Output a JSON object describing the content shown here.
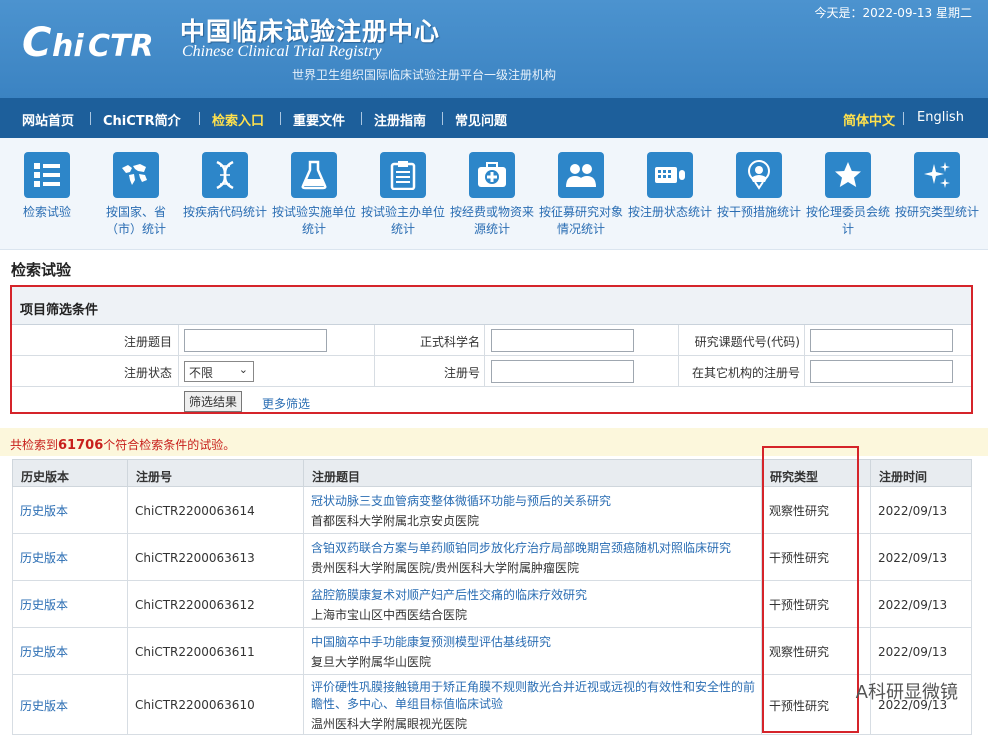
{
  "header": {
    "logo_text": "ChiCTR",
    "title_cn": "中国临床试验注册中心",
    "title_en": "Chinese Clinical Trial Registry",
    "subtitle": "世界卫生组织国际临床试验注册平台一级注册机构",
    "today": "今天是：2022-09-13 星期二",
    "brand_color": "#3f89c8"
  },
  "nav": {
    "items": [
      "网站首页",
      "ChiCTR简介",
      "检索入口",
      "重要文件",
      "注册指南",
      "常见问题"
    ],
    "active": "检索入口",
    "lang_cn": "简体中文",
    "lang_en": "English"
  },
  "icons": [
    {
      "label": "检索试验",
      "icon": "list-icon"
    },
    {
      "label": "按国家、省（市）统计",
      "icon": "map-icon"
    },
    {
      "label": "按疾病代码统计",
      "icon": "dna-icon"
    },
    {
      "label": "按试验实施单位统计",
      "icon": "flask-icon"
    },
    {
      "label": "按试验主办单位统计",
      "icon": "clipboard-icon"
    },
    {
      "label": "按经费或物资来源统计",
      "icon": "medkit-icon"
    },
    {
      "label": "按征募研究对象情况统计",
      "icon": "people-icon"
    },
    {
      "label": "按注册状态统计",
      "icon": "keyboard-icon"
    },
    {
      "label": "按干预措施统计",
      "icon": "doctor-icon"
    },
    {
      "label": "按伦理委员会统计",
      "icon": "star-icon"
    },
    {
      "label": "按研究类型统计",
      "icon": "sparkle-icon"
    }
  ],
  "search": {
    "section_title": "检索试验",
    "filter_title": "项目筛选条件",
    "labels": {
      "reg_title": "注册题目",
      "sci_name": "正式科学名",
      "project_code": "研究课题代号(代码)",
      "reg_status": "注册状态",
      "reg_no": "注册号",
      "other_reg_no": "在其它机构的注册号"
    },
    "status_value": "不限",
    "filter_button": "筛选结果",
    "more_filter": "更多筛选"
  },
  "result": {
    "prefix": "共检索到",
    "count": "61706",
    "suffix": "个符合检索条件的试验。"
  },
  "table": {
    "headers": [
      "历史版本",
      "注册号",
      "注册题目",
      "研究类型",
      "注册时间"
    ],
    "rows": [
      {
        "history": "历史版本",
        "reg_no": "ChiCTR2200063614",
        "title": "冠状动脉三支血管病变整体微循环功能与预后的关系研究",
        "org": "首都医科大学附属北京安贞医院",
        "type": "观察性研究",
        "date": "2022/09/13"
      },
      {
        "history": "历史版本",
        "reg_no": "ChiCTR2200063613",
        "title": "含铂双药联合方案与单药顺铂同步放化疗治疗局部晚期宫颈癌随机对照临床研究",
        "org": "贵州医科大学附属医院/贵州医科大学附属肿瘤医院",
        "type": "干预性研究",
        "date": "2022/09/13"
      },
      {
        "history": "历史版本",
        "reg_no": "ChiCTR2200063612",
        "title": "盆腔筋膜康复术对顺产妇产后性交痛的临床疗效研究",
        "org": "上海市宝山区中西医结合医院",
        "type": "干预性研究",
        "date": "2022/09/13"
      },
      {
        "history": "历史版本",
        "reg_no": "ChiCTR2200063611",
        "title": "中国脑卒中手功能康复预测模型评估基线研究",
        "org": "复旦大学附属华山医院",
        "type": "观察性研究",
        "date": "2022/09/13"
      },
      {
        "history": "历史版本",
        "reg_no": "ChiCTR2200063610",
        "title": "评价硬性巩膜接触镜用于矫正角膜不规则散光合并近视或远视的有效性和安全性的前瞻性、多中心、单组目标值临床试验",
        "org": "温州医科大学附属眼视光医院",
        "type": "干预性研究",
        "date": "2022/09/13"
      }
    ]
  },
  "watermark": "A科研显微镜"
}
